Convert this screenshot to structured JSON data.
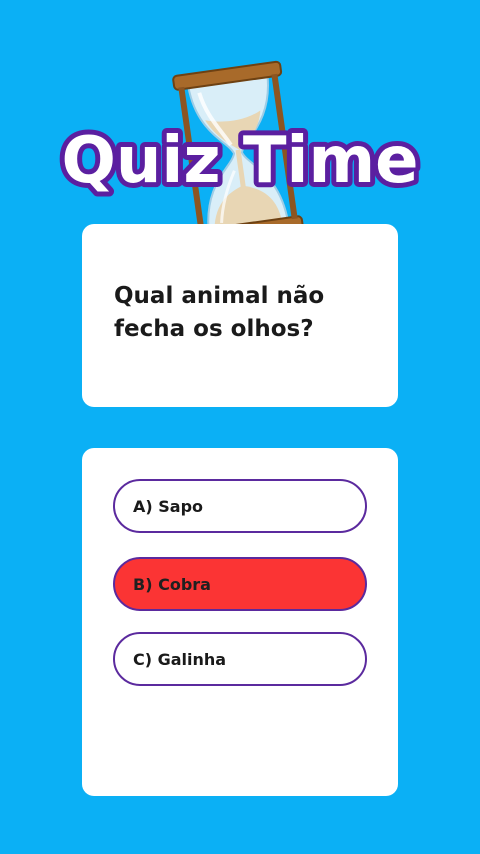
{
  "header": {
    "title": "Quiz Time",
    "icon": "hourglass-icon"
  },
  "question": {
    "text": "Qual animal não fecha os olhos?"
  },
  "options": [
    {
      "label": "A) Sapo",
      "selected": false
    },
    {
      "label": "B) Cobra",
      "selected": true
    },
    {
      "label": "C) Galinha",
      "selected": false
    }
  ],
  "colors": {
    "background": "#0bb0f5",
    "card": "#ffffff",
    "option_border": "#5b2a9e",
    "selected_option": "#fb3434",
    "title_outline": "#5b1fa0"
  }
}
